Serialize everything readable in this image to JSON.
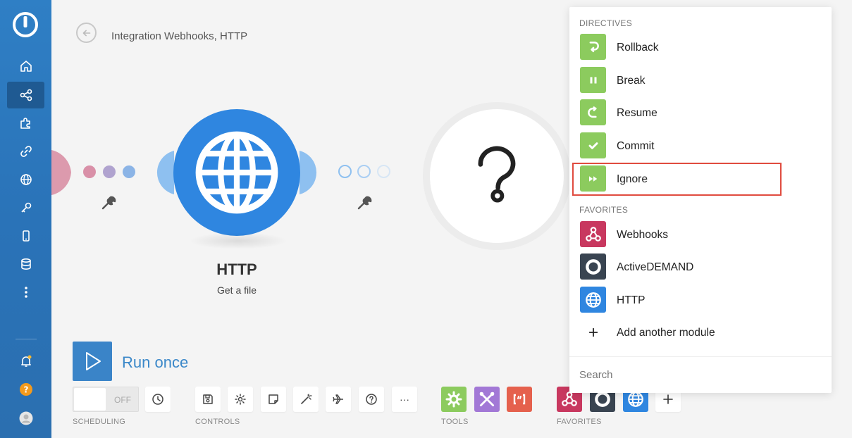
{
  "header": {
    "title": "Integration Webhooks, HTTP"
  },
  "sidebar": {
    "items": [
      "home-icon",
      "share-icon",
      "puzzle-icon",
      "link-icon",
      "globe-icon",
      "key-icon",
      "device-icon",
      "database-icon",
      "more-icon"
    ],
    "active": "share-icon",
    "bottom": [
      "bell-icon",
      "help-icon",
      "avatar"
    ]
  },
  "module": {
    "title": "HTTP",
    "subtitle": "Get a file"
  },
  "run": {
    "label": "Run once"
  },
  "scheduling": {
    "toggle_state": "OFF",
    "caption": "SCHEDULING"
  },
  "captions": {
    "controls": "CONTROLS",
    "tools": "TOOLS",
    "favorites": "FAVORITES"
  },
  "toolbar": {
    "more_label": "···"
  },
  "panel": {
    "directives_header": "DIRECTIVES",
    "directives": [
      {
        "label": "Rollback",
        "icon": "rollback-icon"
      },
      {
        "label": "Break",
        "icon": "pause-icon"
      },
      {
        "label": "Resume",
        "icon": "resume-icon"
      },
      {
        "label": "Commit",
        "icon": "check-icon"
      },
      {
        "label": "Ignore",
        "icon": "fast-forward-icon"
      }
    ],
    "favorites_header": "FAVORITES",
    "favorites": [
      {
        "label": "Webhooks",
        "icon": "webhooks-icon"
      },
      {
        "label": "ActiveDEMAND",
        "icon": "activedemand-icon"
      },
      {
        "label": "HTTP",
        "icon": "globe-icon"
      },
      {
        "label": "Add another module",
        "icon": "plus-icon"
      }
    ],
    "search_placeholder": "Search",
    "highlighted": "Ignore"
  },
  "colors": {
    "sidebar": "#2f7fc5",
    "http": "#2f86e0",
    "directive_green": "#8ccb5e",
    "webhooks": "#c8385f",
    "activedemand": "#394451",
    "highlight": "#e04b3f",
    "run": "#3a84c8"
  }
}
